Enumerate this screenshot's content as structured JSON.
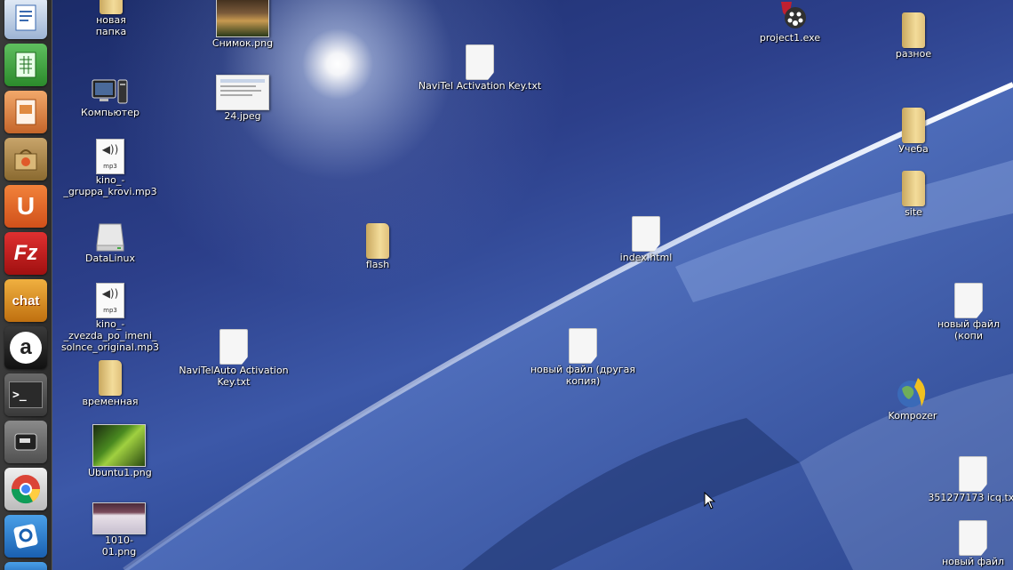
{
  "launcher": {
    "items": [
      {
        "name": "writer-icon",
        "label": ""
      },
      {
        "name": "calc-icon",
        "label": ""
      },
      {
        "name": "impress-icon",
        "label": ""
      },
      {
        "name": "software-center-icon",
        "label": ""
      },
      {
        "name": "ubuntu-one-icon",
        "label": "U"
      },
      {
        "name": "filezilla-icon",
        "label": "Fz"
      },
      {
        "name": "xchat-icon",
        "label": "chat"
      },
      {
        "name": "amarok-icon",
        "label": "a"
      },
      {
        "name": "terminal-icon",
        "label": ">_"
      },
      {
        "name": "drive-icon",
        "label": ""
      },
      {
        "name": "chrome-icon",
        "label": ""
      },
      {
        "name": "qip-icon",
        "label": ""
      }
    ]
  },
  "desktop": {
    "icons": {
      "new_folder": "новая папка",
      "snapshot": "Снимок.png",
      "navitel_key": "NaviTel Activation Key.txt",
      "project1": "project1.exe",
      "raznoe": "разное",
      "computer": "Компьютер",
      "jpeg24": "24.jpeg",
      "ucheba": "Учеба",
      "mp3_krovi": "kino_-_gruppa_krovi.mp3",
      "site": "site",
      "datalinux": "DataLinux",
      "flash": "flash",
      "index_html": "index.html",
      "mp3_zvezda": "kino_-_zvezda_po_imeni_\nsolnce_original.mp3",
      "navitel_auto": "NaviTelAuto Activation\nKey.txt",
      "new_file_copy": "новый файл (другая\nкопия)",
      "new_file_kop": "новый файл (копи",
      "vremennaya": "временная",
      "kompozer": "Kompozer",
      "ubuntu1": "Ubuntu1.png",
      "icq": "351277173 icq.txt",
      "png1010": "1010-01.png",
      "new_file": "новый файл"
    },
    "mp3_badge": "mp3"
  },
  "colors": {
    "launcher_bg": "#2c2c2c",
    "folder": "#e8c87e",
    "label_text": "#ffffff"
  }
}
